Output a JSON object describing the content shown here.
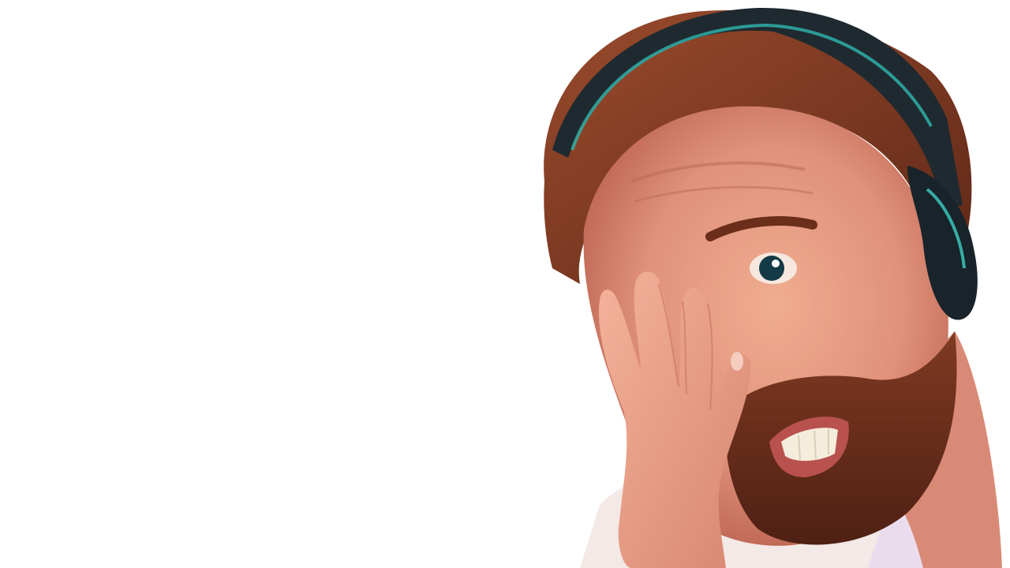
{
  "scene": {
    "subject": "person",
    "background_color": "#ffffff",
    "colors": {
      "skin": "#e49a7f",
      "skin_shadow": "#c46e5a",
      "hair": "#7a3a22",
      "beard": "#6b2f1e",
      "headset": "#1f2a30",
      "headset_rim": "#2fb6b0",
      "shirt": "#f3e9e6",
      "eye": "#143a47",
      "teeth": "#f4eddc",
      "lips": "#b9524f"
    }
  }
}
